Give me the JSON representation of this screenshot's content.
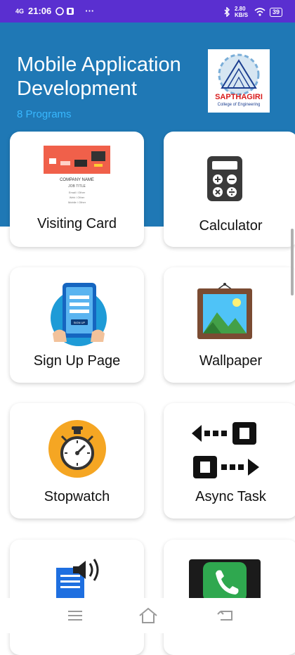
{
  "status_bar": {
    "time": "21:06",
    "network": "4G",
    "speed": "2.80 KB/S",
    "battery": "39",
    "overflow": "···"
  },
  "header": {
    "title": "Mobile Application Development",
    "subtitle": "8 Programs",
    "logo_text": "SAPTHAGIRI",
    "logo_subtext": "College of Engineering"
  },
  "visiting_card_preview": {
    "company": "COMPANY NAME",
    "job": "JOB TITLE",
    "lines": [
      "Email / Other",
      "Web / Other",
      "Mobile / Other"
    ],
    "button": "SIGN UP"
  },
  "programs": [
    {
      "label": "Visiting Card",
      "icon": "visiting-card-icon"
    },
    {
      "label": "Calculator",
      "icon": "calculator-icon"
    },
    {
      "label": "Sign Up Page",
      "icon": "signup-tablet-icon"
    },
    {
      "label": "Wallpaper",
      "icon": "framed-picture-icon"
    },
    {
      "label": "Stopwatch",
      "icon": "stopwatch-icon"
    },
    {
      "label": "Async Task",
      "icon": "arrows-icon"
    },
    {
      "label": "",
      "icon": "document-speaker-icon"
    },
    {
      "label": "",
      "icon": "phone-icon"
    }
  ],
  "colors": {
    "status_bar": "#5a2fd0",
    "header": "#1f78b5",
    "subtitle": "#38b8ff"
  }
}
